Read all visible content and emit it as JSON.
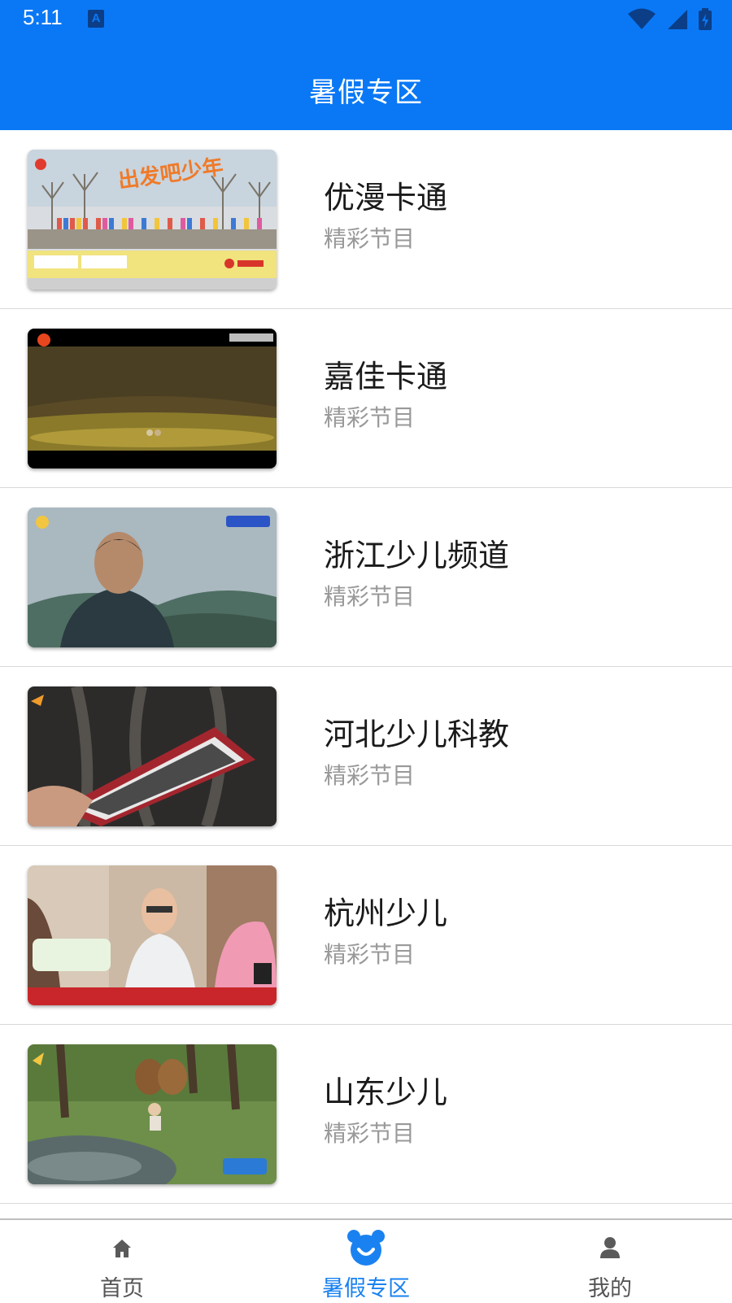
{
  "status_bar": {
    "time": "5:11",
    "notification_icon": "A"
  },
  "toolbar": {
    "title": "暑假专区"
  },
  "items": [
    {
      "title": "优漫卡通",
      "subtitle": "精彩节目",
      "thumb_caption": "出发吧少年"
    },
    {
      "title": "嘉佳卡通",
      "subtitle": "精彩节目"
    },
    {
      "title": "浙江少儿频道",
      "subtitle": "精彩节目"
    },
    {
      "title": "河北少儿科教",
      "subtitle": "精彩节目"
    },
    {
      "title": "杭州少儿",
      "subtitle": "精彩节目"
    },
    {
      "title": "山东少儿",
      "subtitle": "精彩节目"
    }
  ],
  "bottom_nav": {
    "home": {
      "label": "首页",
      "icon": "home-icon"
    },
    "summer": {
      "label": "暑假专区",
      "icon": "bear-icon"
    },
    "mine": {
      "label": "我的",
      "icon": "person-icon"
    }
  },
  "colors": {
    "accent": "#0a78f5",
    "active_tab": "#1a82f0",
    "subtitle": "#999999"
  }
}
